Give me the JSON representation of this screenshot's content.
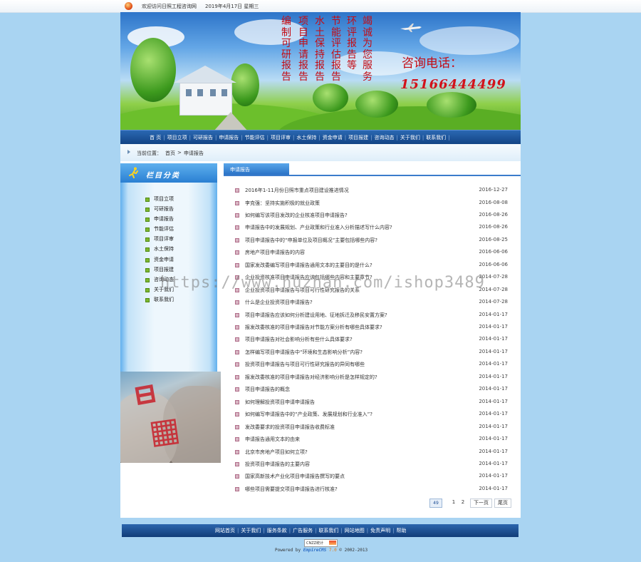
{
  "topbar": {
    "welcome": "欢迎访问日照工程咨询网",
    "date": "2019年4月17日 星期三"
  },
  "banner": {
    "vertical_columns": [
      [
        "编",
        "制",
        "可",
        "研",
        "报",
        "告"
      ],
      [
        "项",
        "目",
        "申",
        "请",
        "报",
        "告"
      ],
      [
        "水",
        "土",
        "保",
        "持",
        "报",
        "告"
      ],
      [
        "节",
        "能",
        "评",
        "估",
        "报",
        "告"
      ],
      [
        "环",
        "评",
        "报",
        "告",
        "等"
      ],
      [
        "竭",
        "诚",
        "为",
        "您",
        "服",
        "务"
      ]
    ],
    "phone_label": "咨询电话：",
    "phone_number": "15166444499"
  },
  "nav": {
    "items": [
      "首 页",
      "项目立项",
      "可研报告",
      "申请报告",
      "节能评估",
      "项目评审",
      "水土保持",
      "资金申请",
      "项目报建",
      "咨询动态",
      "关于我们",
      "联系我们"
    ]
  },
  "breadcrumb": {
    "prefix": "当前位置：",
    "home": "首页",
    "sep": ">",
    "current": "申请报告"
  },
  "sidebar": {
    "title": "栏目分类",
    "items": [
      "项目立项",
      "可研报告",
      "申请报告",
      "节能评估",
      "项目评审",
      "水土保持",
      "资金申请",
      "项目报建",
      "咨询动态",
      "关于我们",
      "联系我们"
    ]
  },
  "main": {
    "tab_label": "申请报告",
    "articles": [
      {
        "title": "2016年1-11月份日照市重点项目建设推进情况",
        "date": "2016-12-27"
      },
      {
        "title": "李克强：坚持实施积极的就业政策",
        "date": "2016-08-08"
      },
      {
        "title": "如何编写该项目发改的企业核准项目申请报告?",
        "date": "2016-08-26"
      },
      {
        "title": "申请报告中的发展规划、产业政策和行业准入分析描述写什么内容?",
        "date": "2016-08-26"
      },
      {
        "title": "项目申请报告中的“申报单位及项目概况”主要包括哪些内容?",
        "date": "2016-08-25"
      },
      {
        "title": "房地产项目申请报告的内容",
        "date": "2016-06-06"
      },
      {
        "title": "国家发改委编写项目申请报告通用文本的主要目的是什么?",
        "date": "2016-06-06"
      },
      {
        "title": "企业投资核准项目申请报告应该包括哪些内容和主要章节?",
        "date": "2014-07-28"
      },
      {
        "title": "企业投资项目申请报告与项目可行性研究报告的关系",
        "date": "2014-07-28"
      },
      {
        "title": "什么是企业投资项目申请报告?",
        "date": "2014-07-28"
      },
      {
        "title": "项目申请报告应该如何分析建设用地、征地拆迁及移民安置方案?",
        "date": "2014-01-17"
      },
      {
        "title": "报发改委核准的项目申请报告对节能方案分析有哪些具体要求?",
        "date": "2014-01-17"
      },
      {
        "title": "项目申请报告对社会影响分析有些什么具体要求?",
        "date": "2014-01-17"
      },
      {
        "title": "怎样编写项目申请报告中“环境和生态影响分析”内容?",
        "date": "2014-01-17"
      },
      {
        "title": "投资项目申请报告与项目可行性研究报告的异同有哪些",
        "date": "2014-01-17"
      },
      {
        "title": "报发改委核准的项目申请报告对经济影响分析是怎样规定的?",
        "date": "2014-01-17"
      },
      {
        "title": "项目申请报告的概念",
        "date": "2014-01-17"
      },
      {
        "title": "如何理解投资项目申请申请报告",
        "date": "2014-01-17"
      },
      {
        "title": "如何编写申请报告中的“产业政策、发展规划和行业准入”?",
        "date": "2014-01-17"
      },
      {
        "title": "发改委要求的投资项目申请报告收费标准",
        "date": "2014-01-17"
      },
      {
        "title": "申请报告通用文本的由来",
        "date": "2014-01-17"
      },
      {
        "title": "北京市房地产项目如何立项?",
        "date": "2014-01-17"
      },
      {
        "title": "投资项目申请报告的主要内容",
        "date": "2014-01-17"
      },
      {
        "title": "国家高新技术产业化项目申请报告撰写的要点",
        "date": "2014-01-17"
      },
      {
        "title": "哪些项目需要提交项目申请报告进行核准?",
        "date": "2014-01-17"
      }
    ],
    "pager": {
      "total_icon": "49",
      "pages": [
        "1",
        "2"
      ],
      "next": "下一页",
      "last": "尾页"
    }
  },
  "footer": {
    "links": [
      "网站首页",
      "关于我们",
      "服务条款",
      "广告服务",
      "联系我们",
      "网站地图",
      "免责声明",
      "帮助"
    ],
    "cnzz": "CNZZ统计",
    "powered_prefix": "Powered by",
    "powered_brand": "EmpireCMS",
    "powered_version": "7.0",
    "powered_copy": "© 2002-2013"
  },
  "watermark": "https://www.huzhan.com/ishop3489",
  "colors": {
    "nav_blue": "#1a4f92",
    "banner_red": "#c40b14",
    "page_bg": "#a9d4f2"
  }
}
